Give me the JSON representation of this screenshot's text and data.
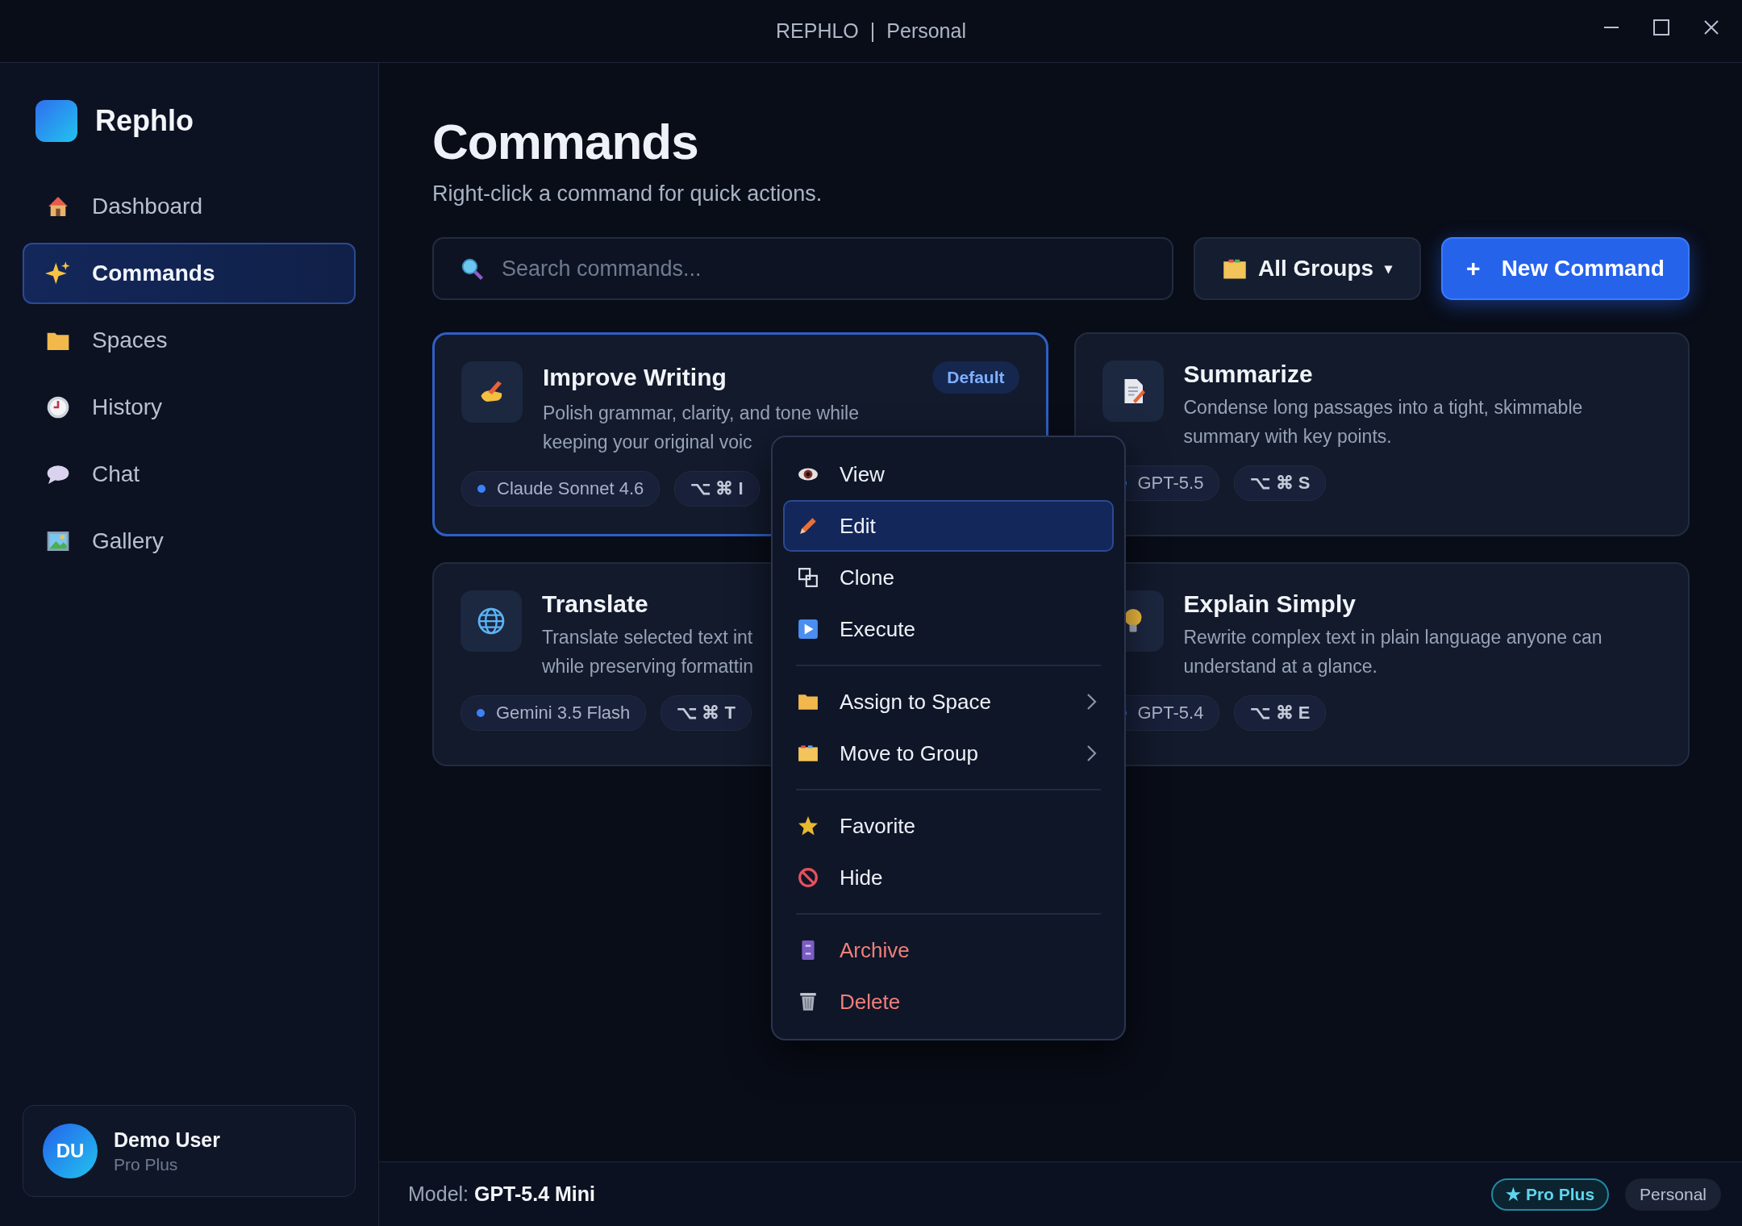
{
  "window": {
    "title": {
      "app": "REPHLO",
      "separator": "|",
      "workspace": "Personal"
    }
  },
  "sidebar": {
    "brand": "Rephlo",
    "items": [
      {
        "label": "Dashboard",
        "selected": false
      },
      {
        "label": "Commands",
        "selected": true
      },
      {
        "label": "Spaces",
        "selected": false
      },
      {
        "label": "History",
        "selected": false
      },
      {
        "label": "Chat",
        "selected": false
      },
      {
        "label": "Gallery",
        "selected": false
      }
    ],
    "user": {
      "initials": "DU",
      "name": "Demo User",
      "plan": "Pro Plus"
    }
  },
  "header": {
    "title": "Commands",
    "subtitle": "Right-click a command for quick actions."
  },
  "toolbar": {
    "search": {
      "placeholder": "Search commands..."
    },
    "group_filter": {
      "label": "All Groups",
      "caret": "▾"
    },
    "new_button": {
      "icon": "+",
      "label": "New Command"
    }
  },
  "commands": [
    {
      "title": "Improve Writing",
      "badge": "Default",
      "selected": true,
      "description": "Polish grammar, clarity, and tone while\nkeeping your original voic",
      "model": "Claude Sonnet 4.6",
      "shortcut": "⌥ ⌘ I"
    },
    {
      "title": "Summarize",
      "selected": false,
      "description": "Condense long passages into a tight, skimmable\nsummary with key points.",
      "model": "GPT-5.5",
      "shortcut": "⌥ ⌘ S"
    },
    {
      "title": "Translate",
      "selected": false,
      "description": "Translate selected text int\nwhile preserving formattin",
      "model": "Gemini 3.5 Flash",
      "shortcut": "⌥ ⌘ T"
    },
    {
      "title": "Explain Simply",
      "selected": false,
      "description": "Rewrite complex text in plain language anyone can\nunderstand at a glance.",
      "model": "GPT-5.4",
      "shortcut": "⌥ ⌘ E"
    }
  ],
  "context_menu": {
    "groups": [
      [
        {
          "label": "View",
          "selected": false,
          "submenu": false,
          "danger": false
        },
        {
          "label": "Edit",
          "selected": true,
          "submenu": false,
          "danger": false
        },
        {
          "label": "Clone",
          "selected": false,
          "submenu": false,
          "danger": false
        },
        {
          "label": "Execute",
          "selected": false,
          "submenu": false,
          "danger": false
        }
      ],
      [
        {
          "label": "Assign to Space",
          "selected": false,
          "submenu": true,
          "danger": false
        },
        {
          "label": "Move to Group",
          "selected": false,
          "submenu": true,
          "danger": false
        }
      ],
      [
        {
          "label": "Favorite",
          "selected": false,
          "submenu": false,
          "danger": false
        },
        {
          "label": "Hide",
          "selected": false,
          "submenu": false,
          "danger": false
        }
      ],
      [
        {
          "label": "Archive",
          "selected": false,
          "submenu": false,
          "danger": true
        },
        {
          "label": "Delete",
          "selected": false,
          "submenu": false,
          "danger": true
        }
      ]
    ]
  },
  "status_bar": {
    "model": "Model: **GPT-5.4 Mini**",
    "plan_badge": "★ Pro Plus",
    "workspace_badge": "Personal"
  }
}
